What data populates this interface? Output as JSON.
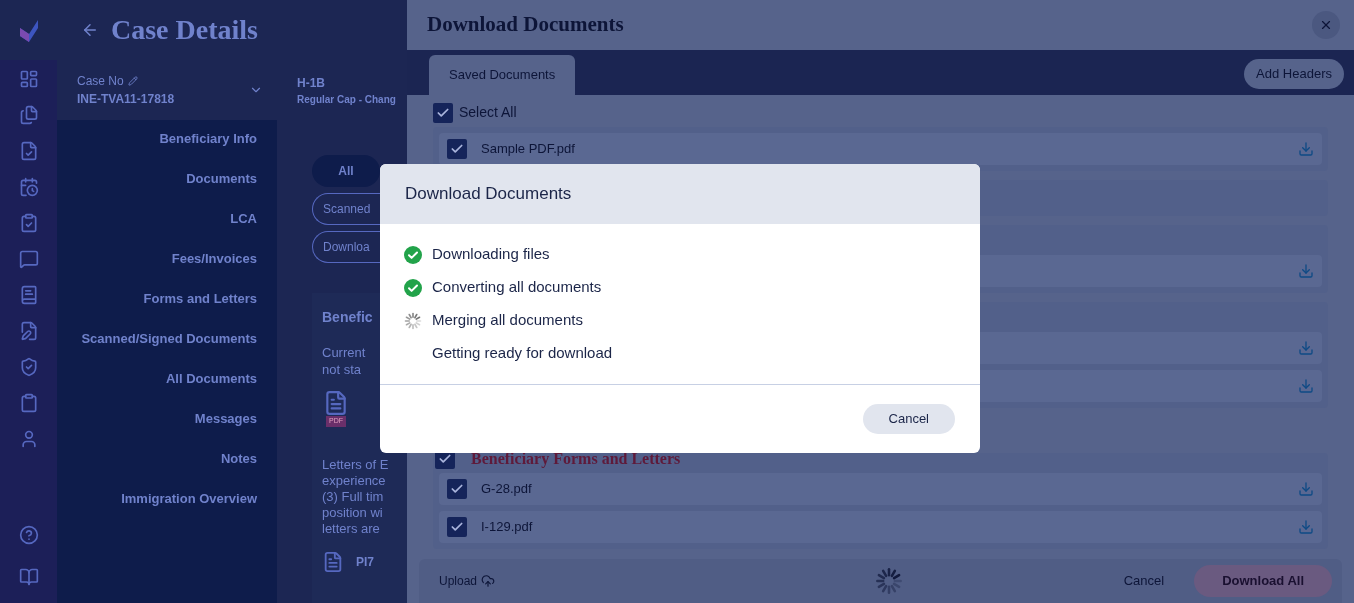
{
  "page_title": "Case Details",
  "case": {
    "label": "Case No",
    "number": "INE-TVA11-17818",
    "visa": "H-1B",
    "visa_sub": "Regular Cap - Chang"
  },
  "nav": [
    {
      "label": "Beneficiary Info"
    },
    {
      "label": "Documents"
    },
    {
      "label": "LCA"
    },
    {
      "label": "Fees/Invoices"
    },
    {
      "label": "Forms and Letters"
    },
    {
      "label": "Scanned/Signed Documents"
    },
    {
      "label": "All Documents"
    },
    {
      "label": "Messages"
    },
    {
      "label": "Notes"
    },
    {
      "label": "Immigration Overview"
    }
  ],
  "filters": [
    {
      "label": "All",
      "selected": true
    },
    {
      "label": "Scanned",
      "selected": false
    },
    {
      "label": "Downloa",
      "selected": false
    }
  ],
  "content": {
    "section": "Benefic",
    "lines_a": [
      "Current",
      "not sta"
    ],
    "lines_b": [
      "Letters of E",
      "experience",
      "(3) Full tim",
      "position wi",
      "letters are"
    ],
    "file_tag": "PDF",
    "file_name": "PI7"
  },
  "drawer": {
    "title": "Download Documents",
    "tabs": [
      {
        "label": "Saved Documents",
        "selected": true
      }
    ],
    "add_headers": "Add Headers",
    "select_all": {
      "label": "Select All",
      "checked": true
    },
    "groups": [
      {
        "kind": "list",
        "files": [
          {
            "kind": "file",
            "name": "Sample PDF.pdf",
            "checked": true
          }
        ]
      },
      {
        "kind": "blank"
      },
      {
        "kind": "list",
        "files": [
          {
            "kind": "covered"
          }
        ]
      },
      {
        "kind": "list",
        "files": [
          {
            "kind": "covered"
          },
          {
            "kind": "covered"
          }
        ]
      },
      {
        "kind": "list",
        "title": "Beneficiary Forms and Letters",
        "checked": true,
        "files": [
          {
            "kind": "file",
            "name": "G-28.pdf",
            "checked": true
          },
          {
            "kind": "file",
            "name": "I-129.pdf",
            "checked": true
          }
        ]
      }
    ],
    "footer": {
      "upload": "Upload",
      "cancel": "Cancel",
      "download_all": "Download All"
    }
  },
  "modal": {
    "title": "Download Documents",
    "steps": [
      {
        "label": "Downloading files",
        "kind": "done"
      },
      {
        "label": "Converting all documents",
        "kind": "done"
      },
      {
        "label": "Merging all documents",
        "kind": "loading"
      },
      {
        "label": "Getting ready for download",
        "kind": "pending"
      }
    ],
    "cancel": "Cancel"
  }
}
